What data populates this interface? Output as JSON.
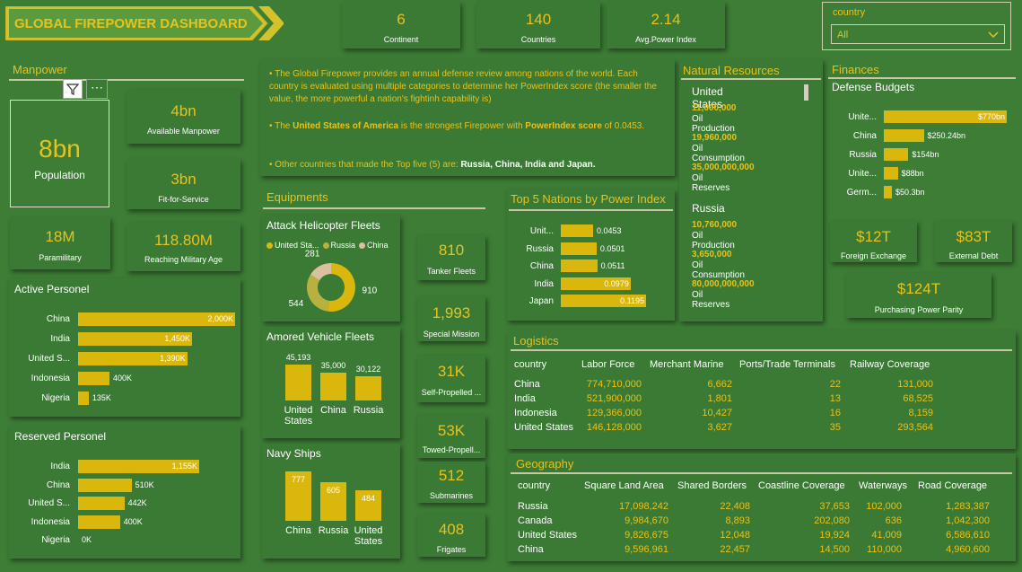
{
  "header": {
    "title": "GLOBAL FIREPOWER DASHBOARD"
  },
  "kpis": [
    {
      "value": "6",
      "label": "Continent"
    },
    {
      "value": "140",
      "label": "Countries"
    },
    {
      "value": "2.14",
      "label": "Avg.Power Index"
    }
  ],
  "filter": {
    "label": "country",
    "value": "All"
  },
  "manpower": {
    "title": "Manpower",
    "population": {
      "value": "8bn",
      "label": "Population"
    },
    "available": {
      "value": "4bn",
      "label": "Available Manpower"
    },
    "fit": {
      "value": "3bn",
      "label": "Fit-for-Service"
    },
    "paramilitary": {
      "value": "18M",
      "label": "Paramilitary"
    },
    "reaching": {
      "value": "118.80M",
      "label": "Reaching Military Age"
    }
  },
  "active": {
    "title": "Active Personel",
    "rows": [
      {
        "label": "China",
        "display": "2,000K",
        "value": 2000
      },
      {
        "label": "India",
        "display": "1,450K",
        "value": 1450
      },
      {
        "label": "United S...",
        "display": "1,390K",
        "value": 1390
      },
      {
        "label": "Indonesia",
        "display": "400K",
        "value": 400
      },
      {
        "label": "Nigeria",
        "display": "135K",
        "value": 135
      }
    ]
  },
  "reserved": {
    "title": "Reserved Personel",
    "rows": [
      {
        "label": "India",
        "display": "1,155K",
        "value": 1155
      },
      {
        "label": "China",
        "display": "510K",
        "value": 510
      },
      {
        "label": "United S...",
        "display": "442K",
        "value": 442
      },
      {
        "label": "Indonesia",
        "display": "400K",
        "value": 400
      },
      {
        "label": "Nigeria",
        "display": "0K",
        "value": 0
      }
    ]
  },
  "intro": {
    "p1": "The Global Firepower provides an annual defense review among nations of the world. Each country is evaluated using multiple categories to determine her PowerIndex score (the smaller the value, the more powerful a nation's fightinh capability is)",
    "p2a": "The ",
    "p2b": "United States of America",
    "p2c": " is the strongest Firepower with ",
    "p2d": "PowerIndex score",
    "p2e": " of 0.0453.",
    "p3a": "Other countries that made the Top five (5) are: ",
    "p3b": "Russia, China, India and Japan."
  },
  "equipments": {
    "title": "Equipments",
    "heli": {
      "title": "Attack Helicopter Fleets",
      "legend": [
        "United Sta...",
        "Russia",
        "China"
      ],
      "values": [
        910,
        544,
        281
      ],
      "labels": [
        "910",
        "544",
        "281"
      ],
      "colors": [
        "#d9b70d",
        "#b8b040",
        "#d8c0a0"
      ]
    },
    "armored": {
      "title": "Amored Vehicle Fleets",
      "cats": [
        "United States",
        "China",
        "Russia"
      ],
      "values": [
        45193,
        35000,
        30122
      ],
      "labels": [
        "45,193",
        "35,000",
        "30,122"
      ]
    },
    "navy": {
      "title": "Navy Ships",
      "cats": [
        "China",
        "Russia",
        "United States"
      ],
      "values": [
        777,
        605,
        484
      ],
      "labels": [
        "777",
        "605",
        "484"
      ]
    }
  },
  "fleet_kpis": [
    {
      "value": "810",
      "label": "Tanker Fleets"
    },
    {
      "value": "1,993",
      "label": "Special Mission"
    },
    {
      "value": "31K",
      "label": "Self-Propelled ..."
    },
    {
      "value": "53K",
      "label": "Towed-Propell..."
    },
    {
      "value": "512",
      "label": "Submarines"
    },
    {
      "value": "408",
      "label": "Frigates"
    }
  ],
  "top5": {
    "title": "Top 5 Nations by Power Index",
    "rows": [
      {
        "label": "Unit...",
        "display": "0.0453",
        "value": 0.0453
      },
      {
        "label": "Russia",
        "display": "0.0501",
        "value": 0.0501
      },
      {
        "label": "China",
        "display": "0.0511",
        "value": 0.0511
      },
      {
        "label": "India",
        "display": "0.0979",
        "value": 0.0979
      },
      {
        "label": "Japan",
        "display": "0.1195",
        "value": 0.1195
      }
    ]
  },
  "natural": {
    "title": "Natural Resources",
    "countries": [
      {
        "name": "United States",
        "items": [
          {
            "v": "11,000,000",
            "l": "Oil Production"
          },
          {
            "v": "19,960,000",
            "l": "Oil Consumption"
          },
          {
            "v": "35,000,000,000",
            "l": "Oil Reserves"
          }
        ]
      },
      {
        "name": "Russia",
        "items": [
          {
            "v": "10,760,000",
            "l": "Oil Production"
          },
          {
            "v": "3,650,000",
            "l": "Oil Consumption"
          },
          {
            "v": "80,000,000,000",
            "l": "Oil Reserves"
          }
        ]
      }
    ]
  },
  "finances": {
    "title": "Finances",
    "subtitle": "Defense Budgets",
    "rows": [
      {
        "label": "Unite...",
        "display": "$770bn",
        "value": 770
      },
      {
        "label": "China",
        "display": "$250.24bn",
        "value": 250.24
      },
      {
        "label": "Russia",
        "display": "$154bn",
        "value": 154
      },
      {
        "label": "Unite...",
        "display": "$88bn",
        "value": 88
      },
      {
        "label": "Germ...",
        "display": "$50.3bn",
        "value": 50.3
      }
    ],
    "fx": {
      "value": "$12T",
      "label": "Foreign Exchange"
    },
    "debt": {
      "value": "$83T",
      "label": "External Debt"
    },
    "ppp": {
      "value": "$124T",
      "label": "Purchasing Power Parity"
    }
  },
  "logistics": {
    "title": "Logistics",
    "headers": [
      "country",
      "Labor Force",
      "Merchant Marine",
      "Ports/Trade Terminals",
      "Railway Coverage"
    ],
    "rows": [
      [
        "China",
        "774,710,000",
        "6,662",
        "22",
        "131,000"
      ],
      [
        "India",
        "521,900,000",
        "1,801",
        "13",
        "68,525"
      ],
      [
        "Indonesia",
        "129,366,000",
        "10,427",
        "16",
        "8,159"
      ],
      [
        "United States",
        "146,128,000",
        "3,627",
        "35",
        "293,564"
      ]
    ]
  },
  "geography": {
    "title": "Geography",
    "headers": [
      "country",
      "Square Land Area",
      "Shared Borders",
      "Coastline Coverage",
      "Waterways",
      "Road Coverage"
    ],
    "rows": [
      [
        "Russia",
        "17,098,242",
        "22,408",
        "37,653",
        "102,000",
        "1,283,387"
      ],
      [
        "Canada",
        "9,984,670",
        "8,893",
        "202,080",
        "636",
        "1,042,300"
      ],
      [
        "United States",
        "9,826,675",
        "12,048",
        "19,924",
        "41,009",
        "6,586,610"
      ],
      [
        "China",
        "9,596,961",
        "22,457",
        "14,500",
        "110,000",
        "4,960,600"
      ]
    ]
  }
}
